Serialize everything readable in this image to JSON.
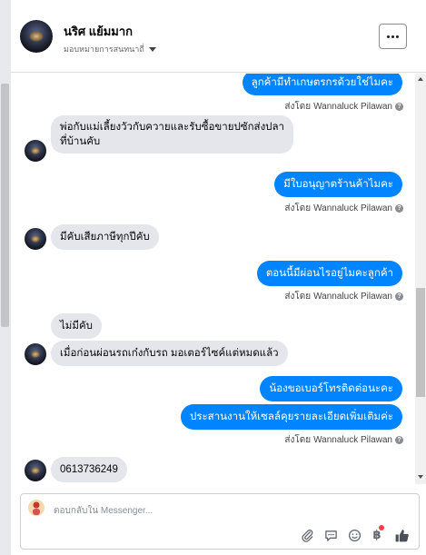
{
  "header": {
    "name": "นริศ แย้มมาก",
    "subtitle": "มอบหมายการสนทนาถี่"
  },
  "sent_by": {
    "prefix": "ส่งโดย",
    "name": "Wannaluck Pilawan"
  },
  "messages": [
    {
      "dir": "out",
      "text": "ลูกค้ามีทำเกษตรกรด้วยใช่ไมคะ"
    },
    {
      "dir": "in",
      "text": "พ่อกับแม่เลี้ยงวัวกับควายและรับซื้อขายปซักส่งปลา"
    },
    {
      "dir": "in",
      "text": "ที่บ้านคับ"
    },
    {
      "dir": "out",
      "text": "มีใบอนุญาตร้านค้าไมคะ"
    },
    {
      "dir": "in",
      "text": "มีคับเสียภาษีทุกปีคับ"
    },
    {
      "dir": "out",
      "text": "ตอนนี้มีผ่อนไรอยู่ไมคะลูกค้า"
    },
    {
      "dir": "in",
      "text": "ไม่มีคับ"
    },
    {
      "dir": "in",
      "text": "เมื่อก่อนผ่อนรถเก๋งกับรถ มอเตอร์ไซค์แต่หมดแล้ว"
    },
    {
      "dir": "out",
      "text": "น้องขอเบอร์โทรติดต่อนะคะ"
    },
    {
      "dir": "out",
      "text": "ประสานงานให้เซลล์คุยรายละเอียดเพิ่มเติมค่ะ"
    },
    {
      "dir": "in",
      "text": "0613736249"
    }
  ],
  "composer": {
    "placeholder": "ตอบกลับใน Messenger..."
  },
  "icons": {
    "attach": "paperclip-icon",
    "quick_reply": "chat-bubble-icon",
    "emoji": "smiley-icon",
    "payment": "baht-icon",
    "like": "thumbs-up-icon"
  },
  "colors": {
    "outgoing_bubble": "#0084ff",
    "incoming_bubble": "#e4e6eb",
    "notification_dot": "#fa3e3e"
  }
}
